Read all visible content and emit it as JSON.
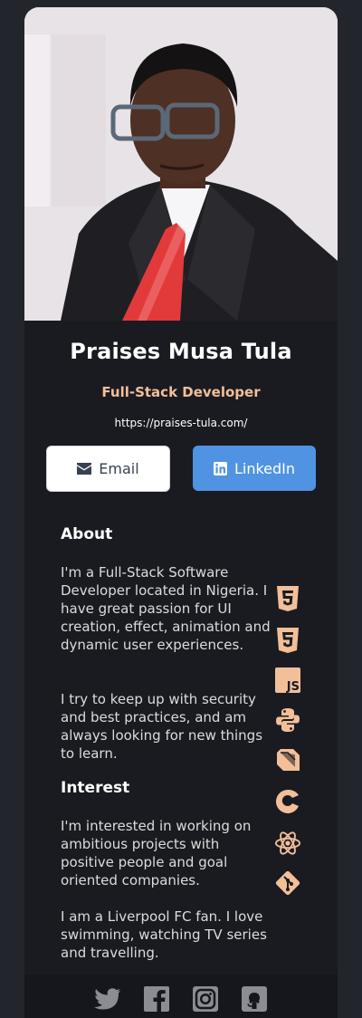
{
  "profile": {
    "name": "Praises Musa Tula",
    "role": "Full-Stack Developer",
    "website": "https://praises-tula.com/"
  },
  "buttons": {
    "email": "Email",
    "linkedin": "LinkedIn"
  },
  "about": {
    "title": "About",
    "p1": "I'm a Full-Stack Software Developer located in Nigeria. I have great passion for UI creation, effect, animation and dynamic user experiences.",
    "p2": "I try to keep up with security and best practices, and am always looking for new things to learn."
  },
  "interest": {
    "title": "Interest",
    "p1": "I'm interested in working on ambitious projects with positive people and goal oriented companies.",
    "p2": "I am a Liverpool FC fan. I love swimming, watching TV series and travelling."
  },
  "skills": [
    "html5-icon",
    "css3-icon",
    "javascript-icon",
    "python-icon",
    "dart-icon",
    "c-icon",
    "react-icon",
    "git-icon"
  ],
  "social": [
    "twitter-icon",
    "facebook-icon",
    "instagram-icon",
    "github-icon"
  ],
  "colors": {
    "background": "#23252c",
    "card": "#1a1b21",
    "accent": "#f3bf99",
    "linkedin": "#5093e2",
    "footer": "#16171c",
    "footer_icon": "#8b8d92"
  }
}
